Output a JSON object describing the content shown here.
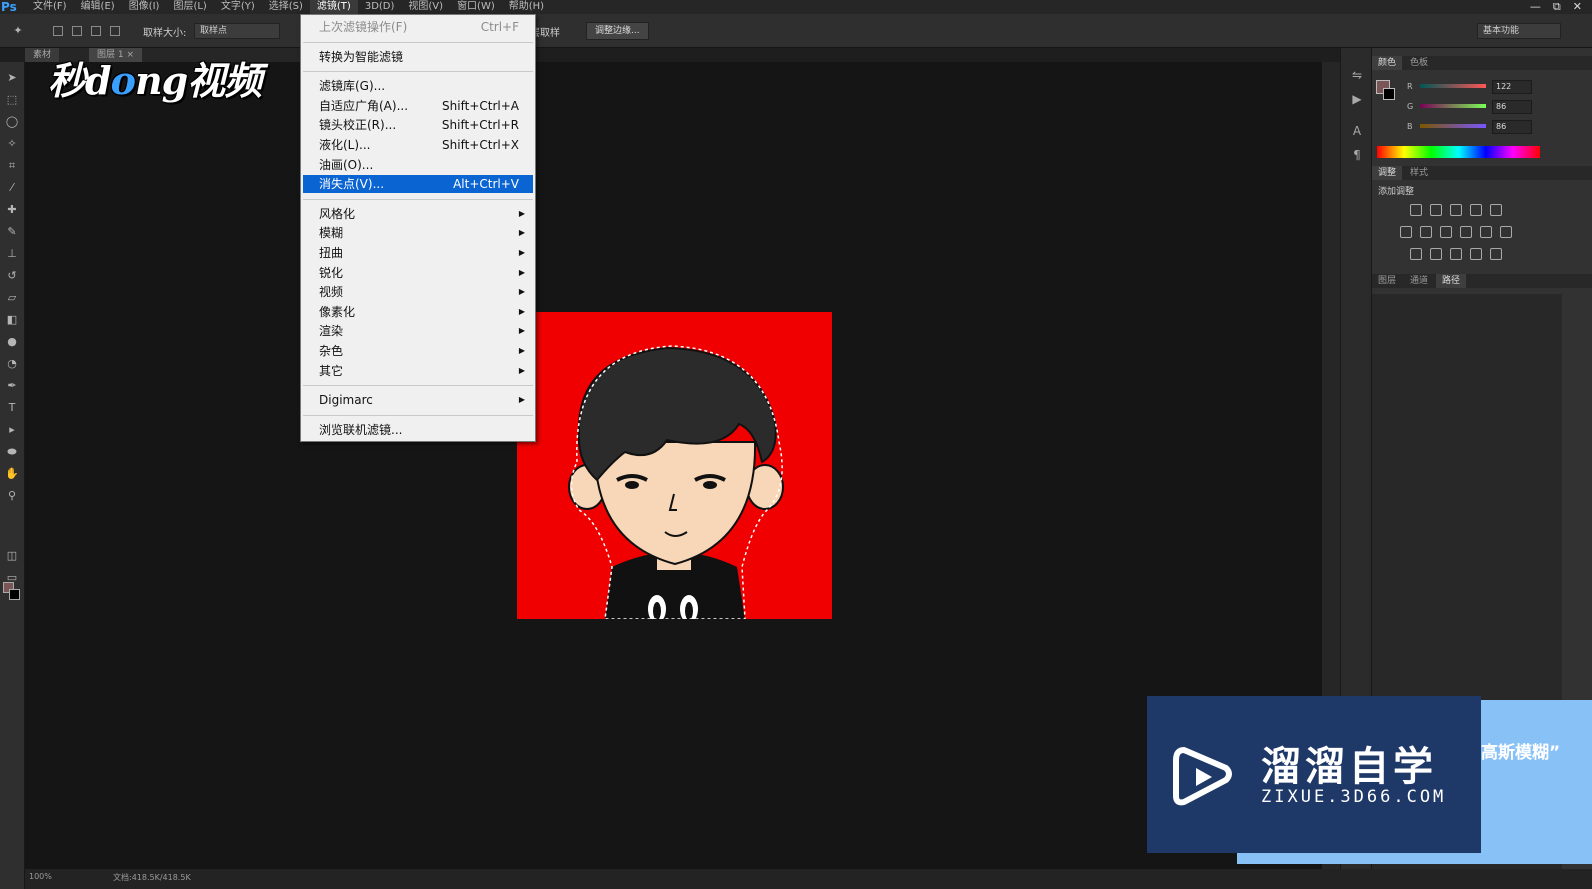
{
  "app": {
    "logo": "Ps"
  },
  "menubar": {
    "items": [
      "文件(F)",
      "编辑(E)",
      "图像(I)",
      "图层(L)",
      "文字(Y)",
      "选择(S)",
      "滤镜(T)",
      "3D(D)",
      "视图(V)",
      "窗口(W)",
      "帮助(H)"
    ],
    "active_index": 6
  },
  "window_controls": {
    "minimize": "—",
    "restore": "⧉",
    "close": "✕"
  },
  "options_bar": {
    "sample_size_label": "取样大小:",
    "sample_size_value": "取样点",
    "sample_all_layers": "对所有图层取样",
    "refine_edge_button": "调整边缘...",
    "workspace": "基本功能"
  },
  "doc_tabs": [
    "素材",
    "图层 1 ×"
  ],
  "filter_menu": {
    "items": [
      {
        "label": "上次滤镜操作(F)",
        "shortcut": "Ctrl+F",
        "disabled": true
      },
      {
        "sep": true
      },
      {
        "label": "转换为智能滤镜"
      },
      {
        "sep": true
      },
      {
        "label": "滤镜库(G)..."
      },
      {
        "label": "自适应广角(A)...",
        "shortcut": "Shift+Ctrl+A"
      },
      {
        "label": "镜头校正(R)...",
        "shortcut": "Shift+Ctrl+R"
      },
      {
        "label": "液化(L)...",
        "shortcut": "Shift+Ctrl+X"
      },
      {
        "label": "油画(O)..."
      },
      {
        "label": "消失点(V)...",
        "shortcut": "Alt+Ctrl+V",
        "highlighted": true
      },
      {
        "sep": true
      },
      {
        "label": "风格化",
        "submenu": true
      },
      {
        "label": "模糊",
        "submenu": true
      },
      {
        "label": "扭曲",
        "submenu": true
      },
      {
        "label": "锐化",
        "submenu": true
      },
      {
        "label": "视频",
        "submenu": true
      },
      {
        "label": "像素化",
        "submenu": true
      },
      {
        "label": "渲染",
        "submenu": true
      },
      {
        "label": "杂色",
        "submenu": true
      },
      {
        "label": "其它",
        "submenu": true
      },
      {
        "sep": true
      },
      {
        "label": "Digimarc",
        "submenu": true
      },
      {
        "sep": true
      },
      {
        "label": "浏览联机滤镜..."
      }
    ]
  },
  "color_panel": {
    "tabs": [
      "颜色",
      "色板"
    ],
    "r_label": "R",
    "g_label": "G",
    "b_label": "B",
    "r": "122",
    "g": "86",
    "b": "86",
    "foreground_hex": "#7a5656"
  },
  "adjust_panel": {
    "tabs": [
      "调整",
      "样式"
    ],
    "title": "添加调整"
  },
  "layers_panel": {
    "tabs": [
      "图层",
      "通道",
      "路径"
    ],
    "selected": 2
  },
  "status_bar": {
    "zoom": "100%",
    "doc_size": "文档:418.5K/418.5K"
  },
  "watermark_left": {
    "pre": "秒d",
    "o": "o",
    "post": "ng视频"
  },
  "watermark_right": {
    "title": "溜溜自学",
    "url": "ZIXUE.3D66.COM",
    "side_text": "高斯模糊”"
  },
  "colors": {
    "canvas_red": "#f00000",
    "menu_highlight": "#0a64d2",
    "watermark_dark": "#1e3868",
    "watermark_light": "#87c1f5"
  }
}
